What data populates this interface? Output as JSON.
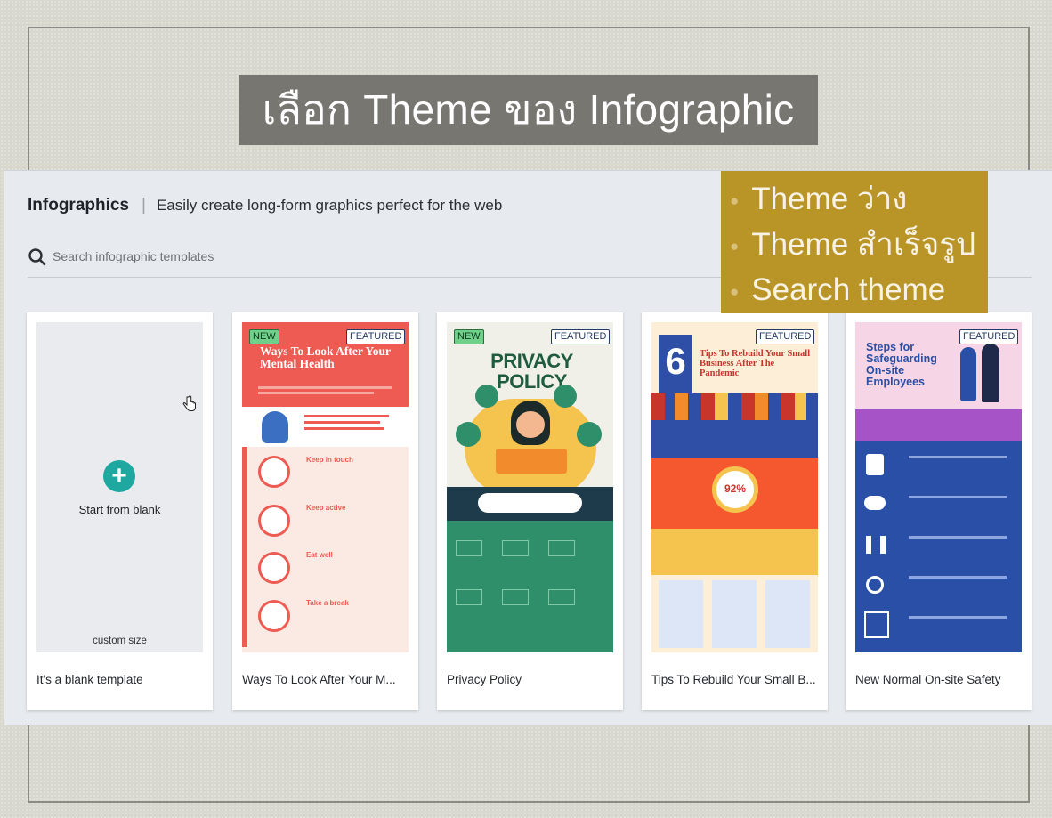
{
  "slide": {
    "title": "เลือก Theme ของ Infographic",
    "bullets": [
      "Theme ว่าง",
      "Theme สำเร็จรูป",
      "Search theme"
    ]
  },
  "header": {
    "brand": "Infographics",
    "separator": "|",
    "subtitle": "Easily create long-form graphics perfect for the web"
  },
  "search": {
    "placeholder": "Search infographic templates"
  },
  "badges": {
    "new": "NEW",
    "featured": "FEATURED"
  },
  "blank": {
    "start_label": "Start from blank",
    "size_label": "custom size"
  },
  "templates": [
    {
      "caption": "It's a blank template"
    },
    {
      "caption": "Ways To Look After Your M...",
      "title": "Ways To Look After Your Mental Health",
      "steps": [
        "Keep in touch",
        "Keep active",
        "Eat well",
        "Take a break"
      ]
    },
    {
      "caption": "Privacy Policy",
      "title": "PRIVACY POLICY"
    },
    {
      "caption": "Tips To Rebuild Your Small B...",
      "number": "6",
      "title": "Tips To Rebuild Your Small Business After The Pandemic",
      "percent": "92%"
    },
    {
      "caption": "New Normal On-site Safety",
      "title": "Steps for Safeguarding On-site Employees"
    }
  ],
  "colors": {
    "overlay": "#b99427",
    "title_bg": "#787670",
    "accent": "#1ea8a0"
  }
}
